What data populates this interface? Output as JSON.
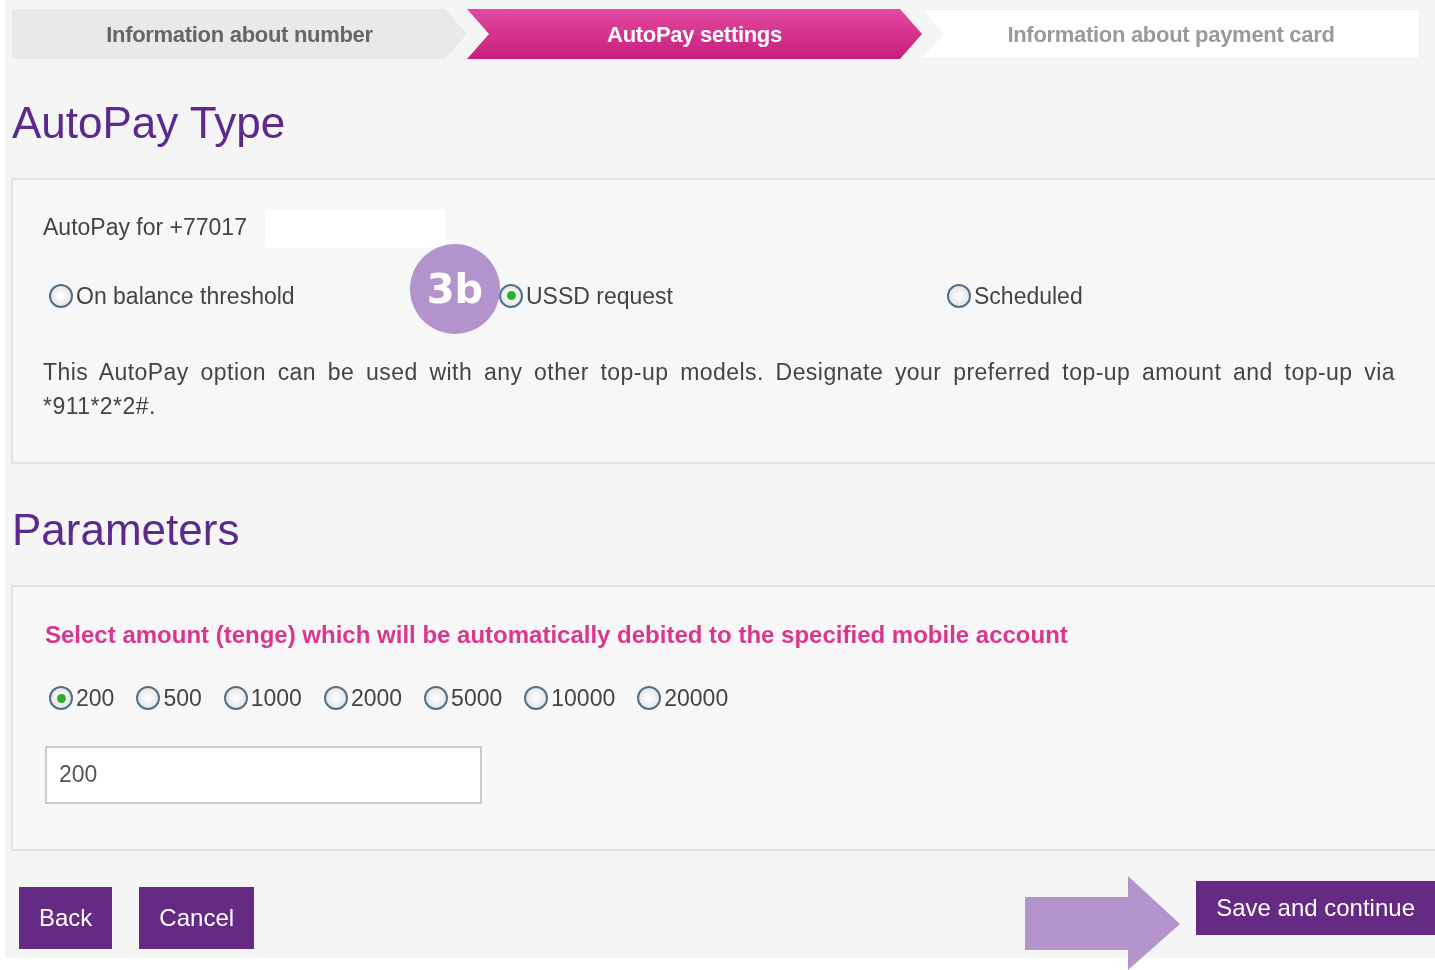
{
  "steps": [
    {
      "label": "Information about number",
      "kind": "done"
    },
    {
      "label": "AutoPay settings",
      "kind": "current"
    },
    {
      "label": "Information about payment card",
      "kind": "upcoming"
    }
  ],
  "autopay_type": {
    "heading": "AutoPay Type",
    "phone_label": "AutoPay for +77017",
    "redacted": true,
    "options": [
      {
        "label": "On balance threshold",
        "selected": false
      },
      {
        "label": "USSD request",
        "selected": true
      },
      {
        "label": "Scheduled",
        "selected": false
      }
    ],
    "description": "This AutoPay option can be used with any other top-up models. Designate your preferred top-up amount and top-up via *911*2*2#."
  },
  "parameters": {
    "heading": "Parameters",
    "prompt": "Select amount (tenge) which will be automatically debited to the specified mobile account",
    "amounts": [
      {
        "label": "200",
        "selected": true
      },
      {
        "label": "500",
        "selected": false
      },
      {
        "label": "1000",
        "selected": false
      },
      {
        "label": "2000",
        "selected": false
      },
      {
        "label": "5000",
        "selected": false
      },
      {
        "label": "10000",
        "selected": false
      },
      {
        "label": "20000",
        "selected": false
      }
    ],
    "amount_value": "200"
  },
  "buttons": [
    {
      "label": "Back"
    },
    {
      "label": "Cancel"
    },
    {
      "label": "Save and continue"
    }
  ],
  "callout": {
    "label": "3b"
  }
}
